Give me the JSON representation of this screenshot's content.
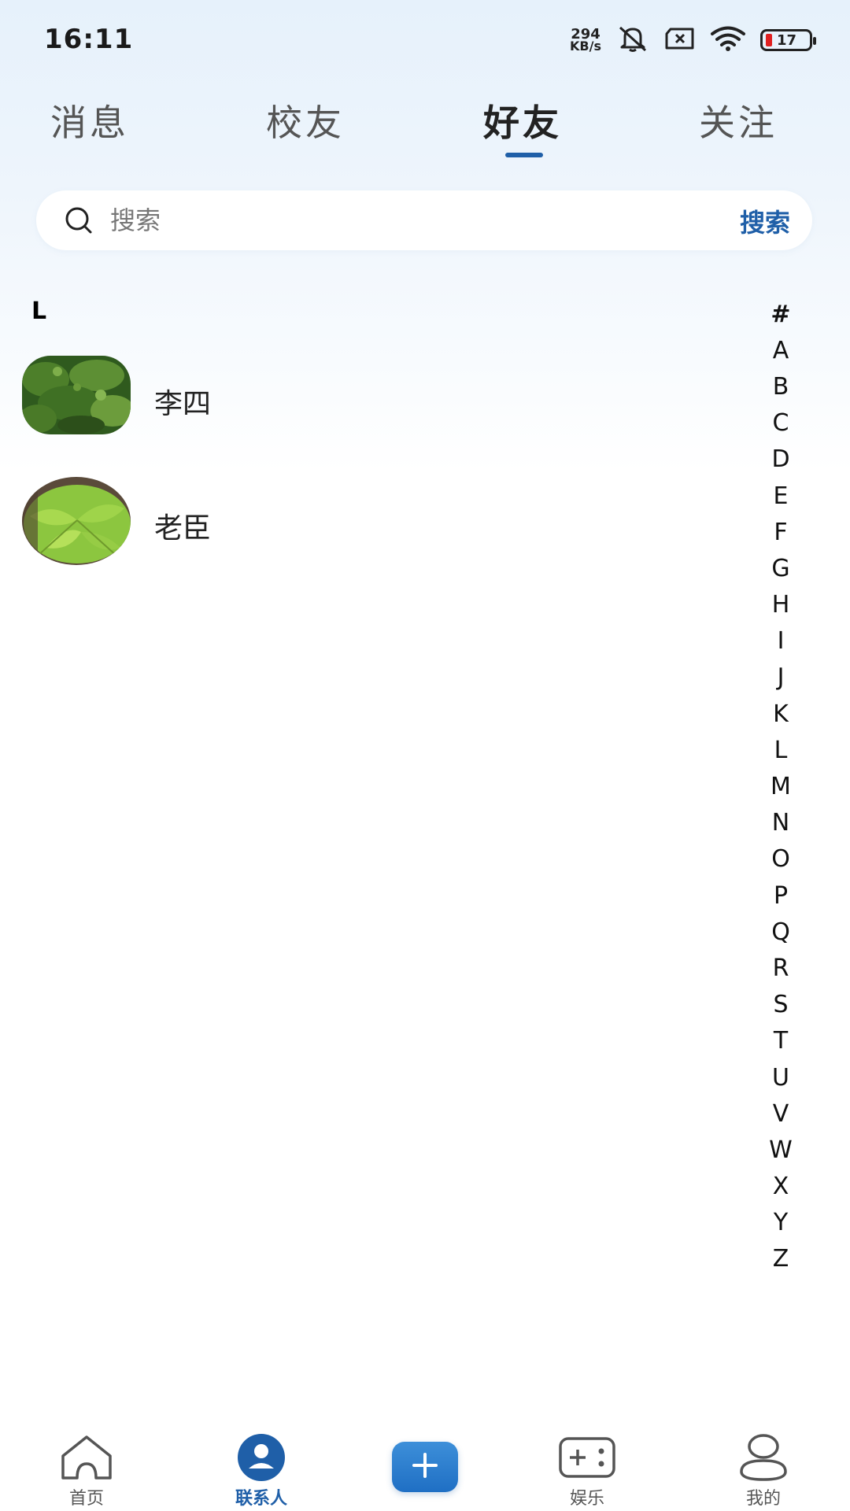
{
  "status_bar": {
    "time": "16:11",
    "net_speed_value": "294",
    "net_speed_unit": "KB/s",
    "battery_level": "17",
    "battery_color": "#e02020",
    "icons": [
      "mute-icon",
      "sim-error-icon",
      "wifi-icon",
      "battery-icon"
    ]
  },
  "top_tabs": {
    "items": [
      {
        "label": "消息",
        "active": false
      },
      {
        "label": "校友",
        "active": false
      },
      {
        "label": "好友",
        "active": true
      },
      {
        "label": "关注",
        "active": false
      }
    ],
    "accent_color": "#1f5fa8"
  },
  "search": {
    "placeholder": "搜索",
    "button_label": "搜索",
    "icon": "search-icon"
  },
  "contacts": {
    "section_letter": "L",
    "items": [
      {
        "name": "李四",
        "avatar": "leaf-photo-dark"
      },
      {
        "name": "老臣",
        "avatar": "leaf-photo-light"
      }
    ]
  },
  "index_bar": {
    "letters": [
      "#",
      "A",
      "B",
      "C",
      "D",
      "E",
      "F",
      "G",
      "H",
      "I",
      "J",
      "K",
      "L",
      "M",
      "N",
      "O",
      "P",
      "Q",
      "R",
      "S",
      "T",
      "U",
      "V",
      "W",
      "X",
      "Y",
      "Z"
    ]
  },
  "bottom_nav": {
    "items": [
      {
        "label": "首页",
        "icon": "home-icon",
        "active": false
      },
      {
        "label": "联系人",
        "icon": "contacts-icon",
        "active": true
      },
      {
        "label": "",
        "icon": "plus-icon",
        "active": false
      },
      {
        "label": "娱乐",
        "icon": "gamepad-icon",
        "active": false
      },
      {
        "label": "我的",
        "icon": "profile-icon",
        "active": false
      }
    ]
  }
}
